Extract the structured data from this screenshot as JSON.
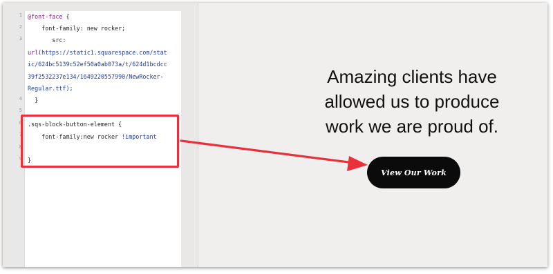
{
  "editor": {
    "line_numbers": [
      "1",
      "2",
      "3",
      "4",
      "5",
      "6",
      "7",
      "8",
      "9"
    ],
    "lines": {
      "l1_kw": "@font-face",
      "l1_rest": " {",
      "l2": "    font-family: new rocker;",
      "l3": "       src:",
      "l3a_prefix": "url",
      "l3a_rest": "(https://static1.squarespace.com/stat",
      "l3b": "ic/624bc5139c52ef50a0ab073a/t/624d1bcdcc",
      "l3c": "39f2532237e134/1649220557990/NewRocker-",
      "l3d": "Regular.ttf);",
      "l4": "  }",
      "l6": ".sqs-block-button-element {",
      "l7_prop": "    font-family:new rocker ",
      "l7_imp": "!important",
      "l9": "}"
    }
  },
  "preview": {
    "headline_lines": [
      "Amazing clients have",
      "allowed us to produce",
      "work we are proud of."
    ],
    "button_label": "View Our Work"
  },
  "colors": {
    "highlight": "#e8313a",
    "button_bg": "#0b0b0b",
    "preview_bg": "#f0efed"
  }
}
